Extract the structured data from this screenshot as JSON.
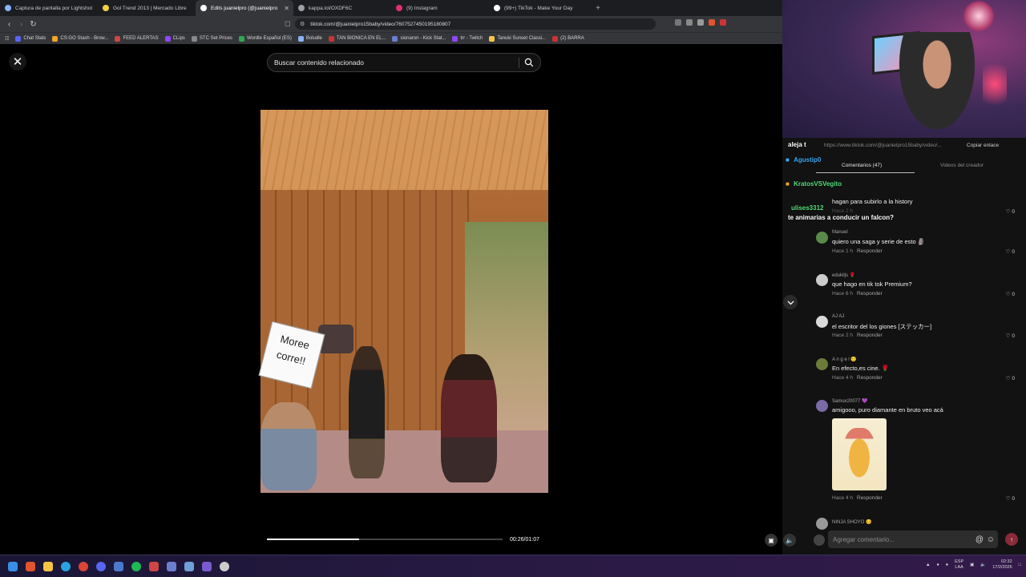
{
  "browser": {
    "tabs": [
      {
        "title": "Captura de pantalla por Lightshot",
        "color": "#8ab4f8"
      },
      {
        "title": "Gol Trend 2013 | Mercado Libre",
        "color": "#f5d142"
      },
      {
        "title": "Edits juanielpro (@juanielpro",
        "color": "#ffffff",
        "active": true
      },
      {
        "title": "kappa.lol/OXDF6C",
        "color": "#9aa0a6"
      },
      {
        "title": "(9) Instagram",
        "color": "#e1306c"
      },
      {
        "title": "(99+) TikTok - Make Your Day",
        "color": "#ffffff"
      }
    ],
    "url": "tiktok.com/@juanielpro15baby/video/7607527450195180807",
    "bookmarks": [
      "Chat Stats",
      "CS:GO Stash - Brow...",
      "FEED ALERTAS",
      "CLips",
      "STC Set Prices",
      "Wordle Español (ES)",
      "Boludle",
      "TAN BIONICA EN EL...",
      "sionaron - Kick Stat...",
      "trr - Twitch",
      "Tanuki Sunset Classi...",
      "(2) BARRA"
    ]
  },
  "viewer": {
    "search_placeholder": "Buscar contenido relacionado",
    "sticker_text_1": "Moree",
    "sticker_text_2": "corre!!",
    "progress": 0.39,
    "timecode": "00:26/01:07"
  },
  "side": {
    "url": "https://www.tiktok.com/@juanielpro15baby/video/...",
    "copy_link": "Copiar enlace",
    "tab_comments": "Comentarios (47)",
    "tab_creator": "Videos del creador",
    "chat": [
      {
        "user": "aleja t",
        "text": ""
      },
      {
        "user": "Agustip0",
        "text": "",
        "color": "#3fa9f5"
      },
      {
        "user": "KratosVSVegito",
        "text": "",
        "color": "#56e07a"
      },
      {
        "user": "ulises3312",
        "text": "",
        "color": "#56e07a"
      },
      {
        "user": "",
        "text": "te animarias a conducir un falcon?"
      }
    ],
    "partial_comment": {
      "text": "hagan para subirlo a la history",
      "time": "Hace 2 h",
      "reply": "Responder",
      "likes": "0"
    },
    "comments": [
      {
        "user": "Manuel",
        "text": "quiero una saga y serie de esto 🗿",
        "time": "Hace 1 h",
        "reply": "Responder",
        "likes": "0",
        "avatar": "#5a8a4a"
      },
      {
        "user": "edukiljs 🌹",
        "text": "que hago en tik tok Premium?",
        "time": "Hace 6 h",
        "reply": "Responder",
        "likes": "0",
        "avatar": "#cccccc"
      },
      {
        "user": "AJ AJ",
        "text": "el escritor del los giones [ステッカー]",
        "time": "Hace 2 h",
        "reply": "Responder",
        "likes": "0",
        "avatar": "#d9d9d9"
      },
      {
        "user": "A n g e l 🙂",
        "text": "En efecto,es cine. 🌹",
        "time": "Hace 4 h",
        "reply": "Responder",
        "likes": "0",
        "avatar": "#6c7a3a"
      },
      {
        "user": "Samux20077 💜",
        "text": "amigooo, puro diamante en bruto veo acá",
        "time": "Hace 4 h",
        "reply": "Responder",
        "likes": "0",
        "avatar": "#7a6aa8"
      }
    ],
    "last_user": "NINJA SHOYO 😊",
    "comment_placeholder": "Agregar comentario..."
  },
  "taskbar": {
    "lang_1": "ESP",
    "lang_2": "LAA",
    "time": "02:32",
    "date": "17/2/2026"
  }
}
